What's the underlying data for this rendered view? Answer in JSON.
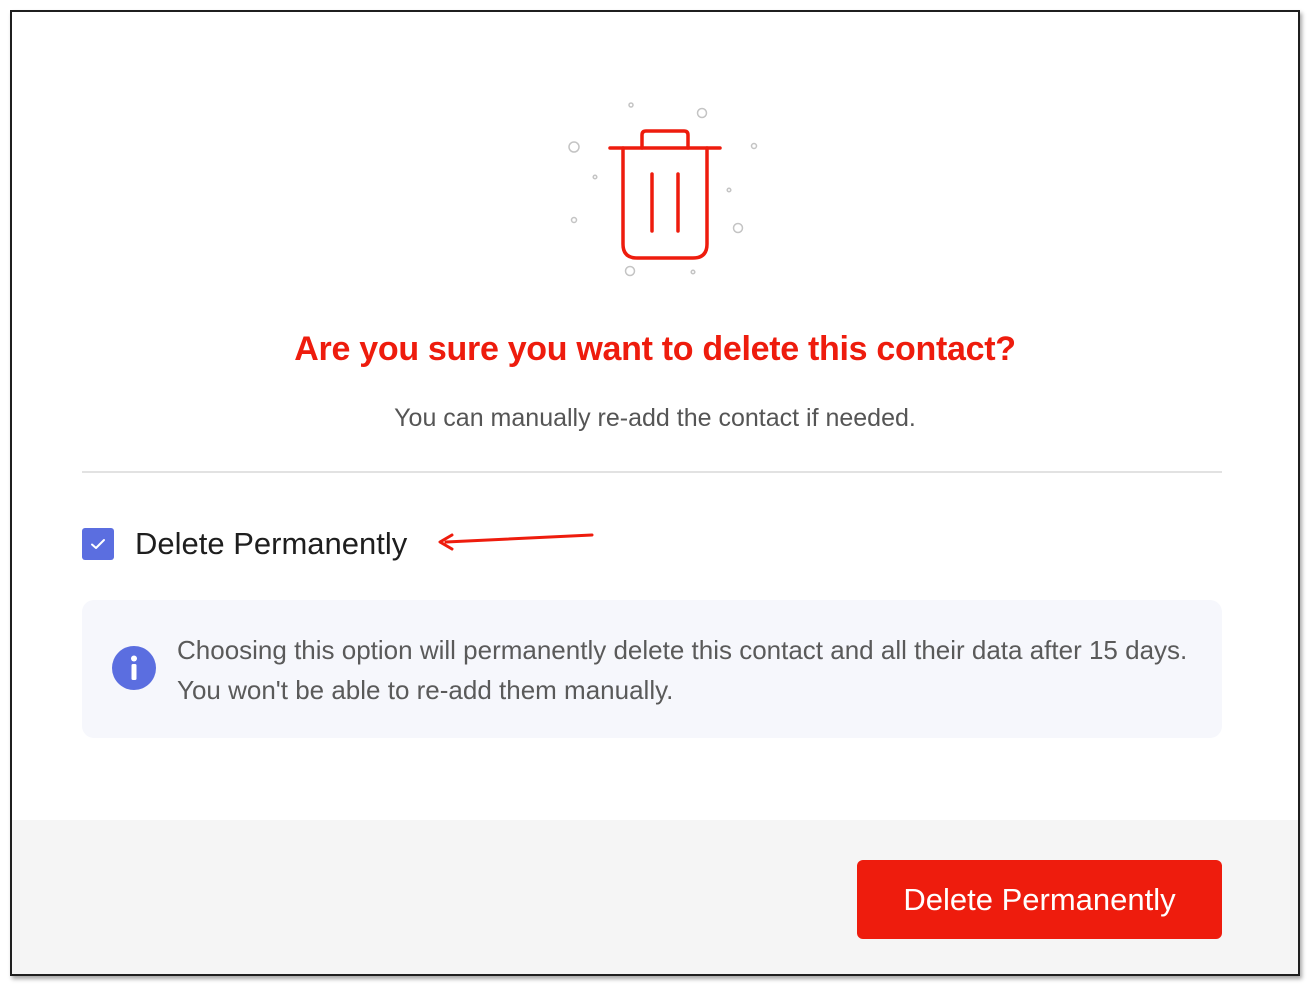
{
  "dialog": {
    "title": "Are you sure you want to delete this contact?",
    "subtitle": "You can manually re-add the contact if needed.",
    "checkbox": {
      "label": "Delete Permanently",
      "checked": true
    },
    "info": {
      "text": "Choosing this option will permanently delete this contact and all their data after 15 days. You won't be able to re-add them manually."
    },
    "footer": {
      "delete_button_label": "Delete Permanently"
    }
  },
  "icons": {
    "illustration": "trash-icon",
    "checkbox_mark": "check-icon",
    "info": "info-icon",
    "annotation": "arrow-icon"
  },
  "colors": {
    "danger": "#ee1c0d",
    "checkbox": "#5b6ee0",
    "info_background": "#f6f7fc",
    "footer_background": "#f5f5f5"
  }
}
